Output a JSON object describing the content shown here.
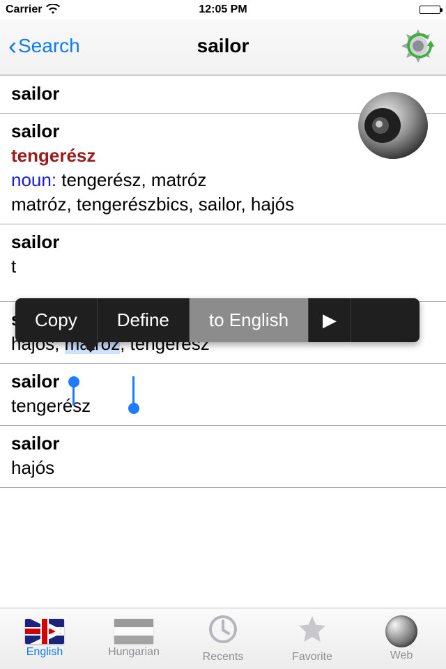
{
  "statusbar": {
    "carrier": "Carrier",
    "time": "12:05 PM"
  },
  "nav": {
    "back_label": "Search",
    "title": "sailor"
  },
  "callout": {
    "copy": "Copy",
    "define": "Define",
    "to_english": "to English",
    "more": "▶"
  },
  "entries": [
    {
      "headword": "sailor"
    },
    {
      "headword": "sailor",
      "primary": "tengerész",
      "pos": "noun:",
      "pos_trans": " tengerész, matróz",
      "extra": "matróz, tengerészbics, sailor, hajós"
    },
    {
      "headword": "sailor",
      "line_trunc": "t"
    },
    {
      "headword": "sailor",
      "line_pre": "hajós; ",
      "line_sel": "matróz",
      "line_post": "; tengerész"
    },
    {
      "headword": "sailor",
      "line": "tengerész"
    },
    {
      "headword": "sailor",
      "line": "hajós"
    }
  ],
  "tabs": {
    "english": "English",
    "hungarian": "Hungarian",
    "recents": "Recents",
    "favorite": "Favorite",
    "web": "Web"
  }
}
